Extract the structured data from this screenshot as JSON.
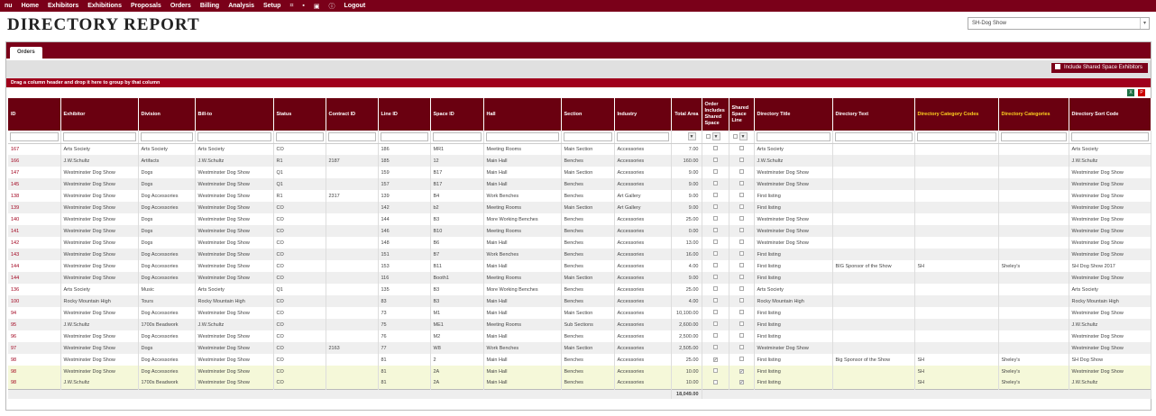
{
  "nav": {
    "items": [
      "nu",
      "Home",
      "Exhibitors",
      "Exhibitions",
      "Proposals",
      "Orders",
      "Billing",
      "Analysis",
      "Setup"
    ],
    "icons": [
      "grid-icon",
      "chat-icon",
      "camera-icon",
      "info-icon"
    ],
    "icon_glyphs": [
      "⌗",
      "▪",
      "▣",
      "ⓘ"
    ],
    "logout": "Logout"
  },
  "page": {
    "title": "DIRECTORY REPORT"
  },
  "show_select": {
    "value": "SH-Dog Show",
    "arrow": "▾"
  },
  "tabs": {
    "orders": "Orders"
  },
  "options": {
    "shared_label": "Include Shared Space Exhibitors"
  },
  "groupbar": "Drag a column header and drop it here to group by that column",
  "export": {
    "excel": "X",
    "pdf": "P"
  },
  "columns": [
    "ID",
    "Exhibitor",
    "Division",
    "Bill-to",
    "Status",
    "Contract ID",
    "Line ID",
    "Space ID",
    "Hall",
    "Section",
    "Industry",
    "Total Area",
    "Order Includes Shared Space",
    "Shared Space Line",
    "Directory Title",
    "Directory Text",
    "Directory Category Codes",
    "Directory Categories",
    "Directory Sort Code"
  ],
  "filter_glyph": "▼",
  "rows": [
    [
      "167",
      "Arts Society",
      "Arts Society",
      "Arts Society",
      "CO",
      "",
      "186",
      "MR1",
      "Meeting Rooms",
      "Main Section",
      "Accessories",
      "7.00",
      "",
      "",
      "Arts Society",
      "",
      "",
      "",
      "Arts Society"
    ],
    [
      "166",
      "J.W.Schultz",
      "Artifacts",
      "J.W.Schultz",
      "R1",
      "2187",
      "185",
      "12",
      "Main Hall",
      "Benches",
      "Accessories",
      "160.00",
      "",
      "",
      "J.W.Schultz",
      "",
      "",
      "",
      "J.W.Schultz"
    ],
    [
      "147",
      "Westminster Dog Show",
      "Dogs",
      "Westminster Dog Show",
      "Q1",
      "",
      "159",
      "B17",
      "Main Hall",
      "Main Section",
      "Accessories",
      "9.00",
      "",
      "",
      "Westminster Dog Show",
      "",
      "",
      "",
      "Westminster Dog Show"
    ],
    [
      "145",
      "Westminster Dog Show",
      "Dogs",
      "Westminster Dog Show",
      "Q1",
      "",
      "157",
      "B17",
      "Main Hall",
      "Benches",
      "Accessories",
      "9.00",
      "",
      "",
      "Westminster Dog Show",
      "",
      "",
      "",
      "Westminster Dog Show"
    ],
    [
      "138",
      "Westminster Dog Show",
      "Dog Accessories",
      "Westminster Dog Show",
      "R1",
      "2317",
      "139",
      "B4",
      "Work Benches",
      "Benches",
      "Art Gallery",
      "9.00",
      "",
      "",
      "First listing",
      "",
      "",
      "",
      "Westminster Dog Show"
    ],
    [
      "139",
      "Westminster Dog Show",
      "Dog Accessories",
      "Westminster Dog Show",
      "CO",
      "",
      "142",
      "b2",
      "Meeting Rooms",
      "Main Section",
      "Art Gallery",
      "9.00",
      "",
      "",
      "First listing",
      "",
      "",
      "",
      "Westminster Dog Show"
    ],
    [
      "140",
      "Westminster Dog Show",
      "Dogs",
      "Westminster Dog Show",
      "CO",
      "",
      "144",
      "B3",
      "More Working Benches",
      "Benches",
      "Accessories",
      "25.00",
      "",
      "",
      "Westminster Dog Show",
      "",
      "",
      "",
      "Westminster Dog Show"
    ],
    [
      "141",
      "Westminster Dog Show",
      "Dogs",
      "Westminster Dog Show",
      "CO",
      "",
      "146",
      "B10",
      "Meeting Rooms",
      "Benches",
      "Accessories",
      "0.00",
      "",
      "",
      "Westminster Dog Show",
      "",
      "",
      "",
      "Westminster Dog Show"
    ],
    [
      "142",
      "Westminster Dog Show",
      "Dogs",
      "Westminster Dog Show",
      "CO",
      "",
      "148",
      "B6",
      "Main Hall",
      "Benches",
      "Accessories",
      "13.00",
      "",
      "",
      "Westminster Dog Show",
      "",
      "",
      "",
      "Westminster Dog Show"
    ],
    [
      "143",
      "Westminster Dog Show",
      "Dog Accessories",
      "Westminster Dog Show",
      "CO",
      "",
      "151",
      "B7",
      "Work Benches",
      "Benches",
      "Accessories",
      "16.00",
      "",
      "",
      "First listing",
      "",
      "",
      "",
      "Westminster Dog Show"
    ],
    [
      "144",
      "Westminster Dog Show",
      "Dog Accessories",
      "Westminster Dog Show",
      "CO",
      "",
      "153",
      "B11",
      "Main Hall",
      "Benches",
      "Accessories",
      "4.00",
      "",
      "",
      "First listing",
      "BIG Sponsor of the Show",
      "SH",
      "Sheley's",
      "SH Dog Show 2017"
    ],
    [
      "144",
      "Westminster Dog Show",
      "Dog Accessories",
      "Westminster Dog Show",
      "CO",
      "",
      "116",
      "Booth1",
      "Meeting Rooms",
      "Main Section",
      "Accessories",
      "9.00",
      "",
      "",
      "First listing",
      "",
      "",
      "",
      "Westminster Dog Show"
    ],
    [
      "136",
      "Arts Society",
      "Music",
      "Arts Society",
      "Q1",
      "",
      "135",
      "B3",
      "More Working Benches",
      "Benches",
      "Accessories",
      "25.00",
      "",
      "",
      "Arts Society",
      "",
      "",
      "",
      "Arts Society"
    ],
    [
      "100",
      "Rocky Mountain High",
      "Tours",
      "Rocky Mountain High",
      "CO",
      "",
      "83",
      "B3",
      "Main Hall",
      "Benches",
      "Accessories",
      "4.00",
      "",
      "",
      "Rocky Mountain High",
      "",
      "",
      "",
      "Rocky Mountain High"
    ],
    [
      "94",
      "Westminster Dog Show",
      "Dog Accessories",
      "Westminster Dog Show",
      "CO",
      "",
      "73",
      "M1",
      "Main Hall",
      "Main Section",
      "Accessories",
      "10,100.00",
      "",
      "",
      "First listing",
      "",
      "",
      "",
      "Westminster Dog Show"
    ],
    [
      "95",
      "J.W.Schultz",
      "1700s Beadwork",
      "J.W.Schultz",
      "CO",
      "",
      "75",
      "ME1",
      "Meeting Rooms",
      "Sub Sections",
      "Accessories",
      "2,600.00",
      "",
      "",
      "First listing",
      "",
      "",
      "",
      "J.W.Schultz"
    ],
    [
      "96",
      "Westminster Dog Show",
      "Dog Accessories",
      "Westminster Dog Show",
      "CO",
      "",
      "76",
      "M2",
      "Main Hall",
      "Benches",
      "Accessories",
      "2,500.00",
      "",
      "",
      "First listing",
      "",
      "",
      "",
      "Westminster Dog Show"
    ],
    [
      "97",
      "Westminster Dog Show",
      "Dogs",
      "Westminster Dog Show",
      "CO",
      "2163",
      "77",
      "W8",
      "Work Benches",
      "Main Section",
      "Accessories",
      "2,505.00",
      "",
      "",
      "Westminster Dog Show",
      "",
      "",
      "",
      "Westminster Dog Show"
    ],
    [
      "98",
      "Westminster Dog Show",
      "Dog Accessories",
      "Westminster Dog Show",
      "CO",
      "",
      "81",
      "2",
      "Main Hall",
      "Benches",
      "Accessories",
      "25.00",
      "✓",
      "",
      "First listing",
      "Big Sponsor of the Show",
      "SH",
      "Sheley's",
      "SH Dog Show"
    ],
    [
      "98",
      "Westminster Dog Show",
      "Dog Accessories",
      "Westminster Dog Show",
      "CO",
      "",
      "81",
      "2A",
      "Main Hall",
      "Benches",
      "Accessories",
      "10.00",
      "",
      "✓",
      "First listing",
      "",
      "SH",
      "Sheley's",
      "Westminster Dog Show"
    ],
    [
      "98",
      "J.W.Schultz",
      "1700s Beadwork",
      "Westminster Dog Show",
      "CO",
      "",
      "81",
      "2A",
      "Main Hall",
      "Benches",
      "Accessories",
      "10.00",
      "",
      "✓",
      "First listing",
      "",
      "SH",
      "Sheley's",
      "J.W.Schultz"
    ]
  ],
  "highlighted_rows": [
    19,
    20
  ],
  "total_area": "18,049.00"
}
